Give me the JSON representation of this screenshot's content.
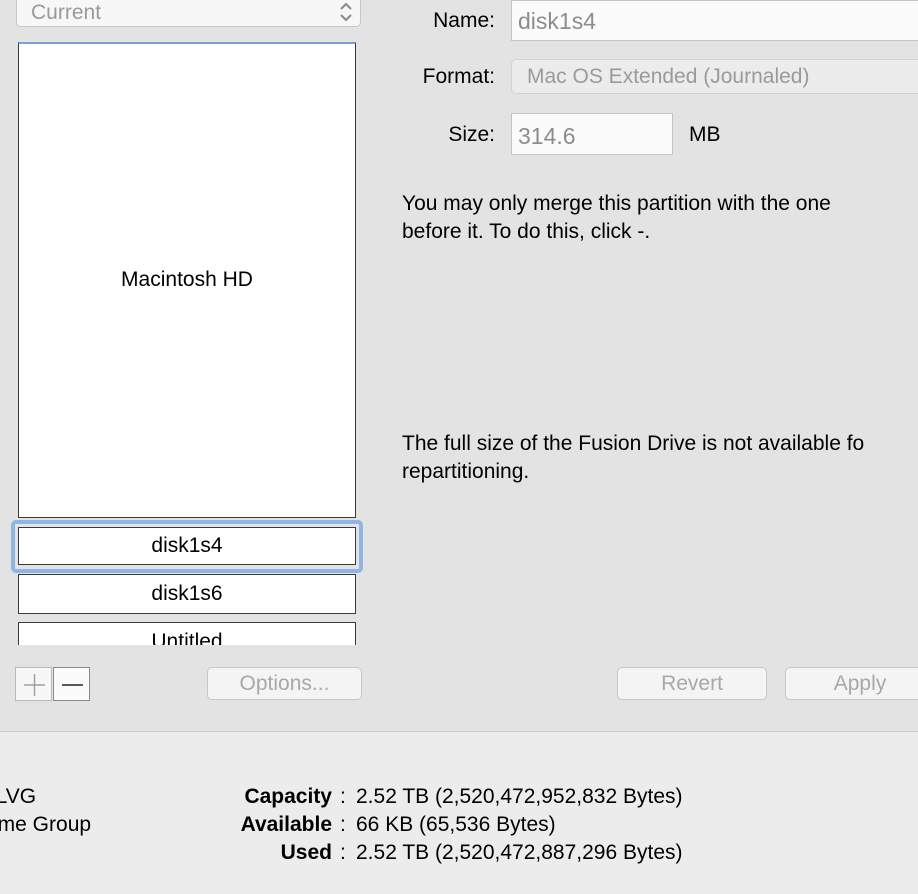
{
  "partition": {
    "layout_popup": {
      "value": "Current",
      "icon": "chevron-updown-icon"
    },
    "map": [
      {
        "label": "Macintosh HD"
      },
      {
        "label": "disk1s4",
        "selected": true
      },
      {
        "label": "disk1s6"
      },
      {
        "label": "Untitled"
      }
    ],
    "add_button": {
      "icon": "plus-icon"
    },
    "remove_button": {
      "icon": "minus-icon"
    },
    "options_label": "Options..."
  },
  "form": {
    "name_label": "Name:",
    "name_value": "disk1s4",
    "format_label": "Format:",
    "format_value": "Mac OS Extended (Journaled)",
    "size_label": "Size:",
    "size_value": "314.6",
    "size_unit": "MB",
    "message_merge": "You may only merge this partition with the one\nbefore it. To do this, click -.",
    "message_fusion": "The full size of the Fusion Drive is not available fo\nrepartitioning.",
    "revert_label": "Revert",
    "apply_label": "Apply"
  },
  "info": {
    "left_clipped": [
      "nLVG",
      "ume Group"
    ],
    "rows": [
      {
        "key": "Capacity",
        "value": "2.52 TB (2,520,472,952,832 Bytes)"
      },
      {
        "key": "Available",
        "value": "66 KB (65,536 Bytes)"
      },
      {
        "key": "Used",
        "value": "2.52 TB (2,520,472,887,296 Bytes)"
      }
    ]
  },
  "colors": {
    "selection_ring": "#8fb4e6",
    "window_bg": "#e3e3e3",
    "disabled_text": "#a8a8a8"
  }
}
